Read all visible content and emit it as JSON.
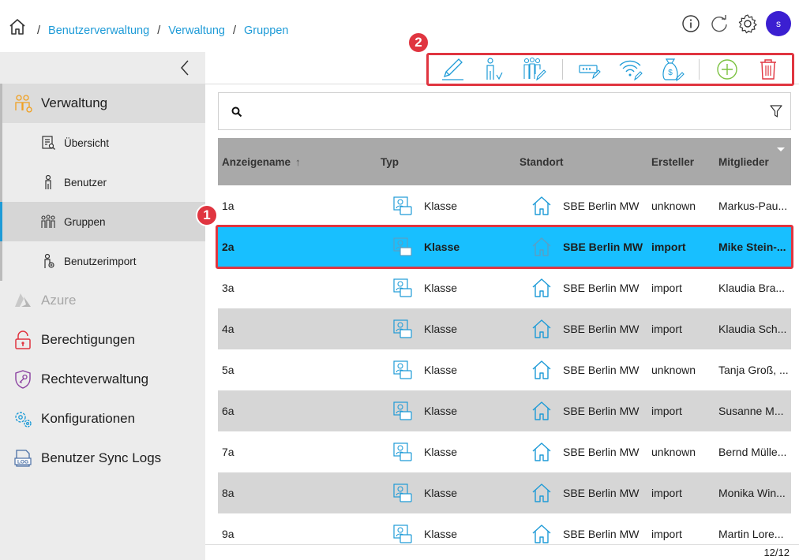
{
  "breadcrumb": {
    "items": [
      "Benutzerverwaltung",
      "Verwaltung",
      "Gruppen"
    ]
  },
  "header": {
    "avatar_initial": "s",
    "icons": [
      "info-icon",
      "refresh-icon",
      "settings-icon"
    ]
  },
  "sidebar": {
    "items": [
      {
        "label": "Verwaltung",
        "icon": "users-admin-icon"
      },
      {
        "label": "Übersicht",
        "icon": "overview-icon"
      },
      {
        "label": "Benutzer",
        "icon": "user-icon"
      },
      {
        "label": "Gruppen",
        "icon": "groups-icon"
      },
      {
        "label": "Benutzerimport",
        "icon": "user-import-icon"
      },
      {
        "label": "Azure",
        "icon": "azure-icon"
      },
      {
        "label": "Berechtigungen",
        "icon": "lock-icon"
      },
      {
        "label": "Rechteverwaltung",
        "icon": "shield-key-icon"
      },
      {
        "label": "Konfigurationen",
        "icon": "gears-icon"
      },
      {
        "label": "Benutzer Sync Logs",
        "icon": "log-icon"
      }
    ]
  },
  "annotations": {
    "badge1": "1",
    "badge2": "2"
  },
  "toolbar": {
    "icons": [
      "edit-icon",
      "assign-user-icon",
      "edit-group-icon",
      "password-icon",
      "wifi-edit-icon",
      "money-edit-icon",
      "add-icon",
      "delete-icon"
    ]
  },
  "search": {
    "placeholder": ""
  },
  "table": {
    "columns": [
      "Anzeigename",
      "Typ",
      "Standort",
      "Ersteller",
      "Mitglieder"
    ],
    "rows": [
      {
        "name": "1a",
        "typ": "Klasse",
        "standort": "SBE Berlin MW",
        "ersteller": "unknown",
        "mitglieder": "Markus-Pau..."
      },
      {
        "name": "2a",
        "typ": "Klasse",
        "standort": "SBE Berlin MW",
        "ersteller": "import",
        "mitglieder": "Mike Stein-..."
      },
      {
        "name": "3a",
        "typ": "Klasse",
        "standort": "SBE Berlin MW",
        "ersteller": "import",
        "mitglieder": "Klaudia Bra..."
      },
      {
        "name": "4a",
        "typ": "Klasse",
        "standort": "SBE Berlin MW",
        "ersteller": "import",
        "mitglieder": "Klaudia Sch..."
      },
      {
        "name": "5a",
        "typ": "Klasse",
        "standort": "SBE Berlin MW",
        "ersteller": "unknown",
        "mitglieder": "Tanja Groß, ..."
      },
      {
        "name": "6a",
        "typ": "Klasse",
        "standort": "SBE Berlin MW",
        "ersteller": "import",
        "mitglieder": "Susanne M..."
      },
      {
        "name": "7a",
        "typ": "Klasse",
        "standort": "SBE Berlin MW",
        "ersteller": "unknown",
        "mitglieder": "Bernd Mülle..."
      },
      {
        "name": "8a",
        "typ": "Klasse",
        "standort": "SBE Berlin MW",
        "ersteller": "import",
        "mitglieder": "Monika Win..."
      },
      {
        "name": "9a",
        "typ": "Klasse",
        "standort": "SBE Berlin MW",
        "ersteller": "import",
        "mitglieder": "Martin Lore..."
      }
    ],
    "selected_index": 1,
    "page_count": "12/12"
  },
  "colors": {
    "accent": "#1e9bd7",
    "selected_row": "#18bfff",
    "highlight": "#e03540",
    "add": "#7cc242",
    "delete": "#e03540"
  }
}
